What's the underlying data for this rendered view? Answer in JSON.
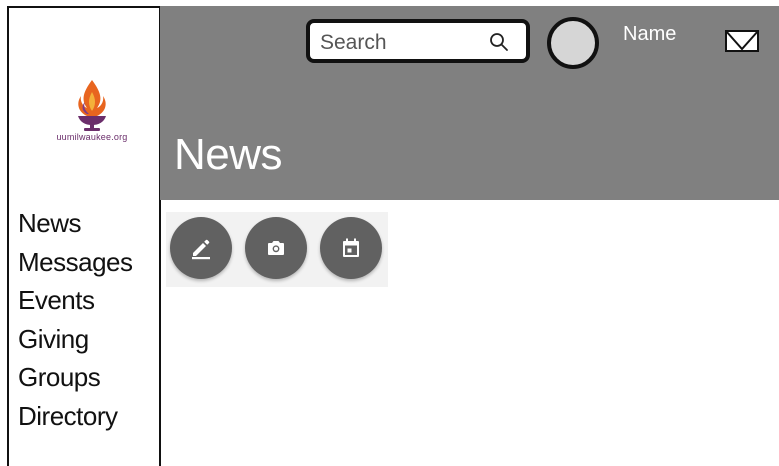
{
  "logo": {
    "text": "uumilwaukee.org",
    "icon": "flaming-chalice-logo"
  },
  "sidebar": {
    "items": [
      {
        "label": "News"
      },
      {
        "label": "Messages"
      },
      {
        "label": "Events"
      },
      {
        "label": "Giving"
      },
      {
        "label": "Groups"
      },
      {
        "label": "Directory"
      }
    ]
  },
  "header": {
    "search": {
      "placeholder": "Search",
      "icon": "search-icon"
    },
    "user": {
      "name": "Name",
      "avatar": "avatar-placeholder"
    },
    "mail_icon": "mail-icon",
    "page_title": "News",
    "background": "#808080"
  },
  "actions": [
    {
      "icon": "edit-icon",
      "label": ""
    },
    {
      "icon": "camera-icon",
      "label": ""
    },
    {
      "icon": "calendar-icon",
      "label": ""
    }
  ],
  "colors": {
    "header_bg": "#808080",
    "fab_bg": "#616161",
    "logo_flame": "#e05a1e",
    "logo_text": "#6b2e6b"
  }
}
